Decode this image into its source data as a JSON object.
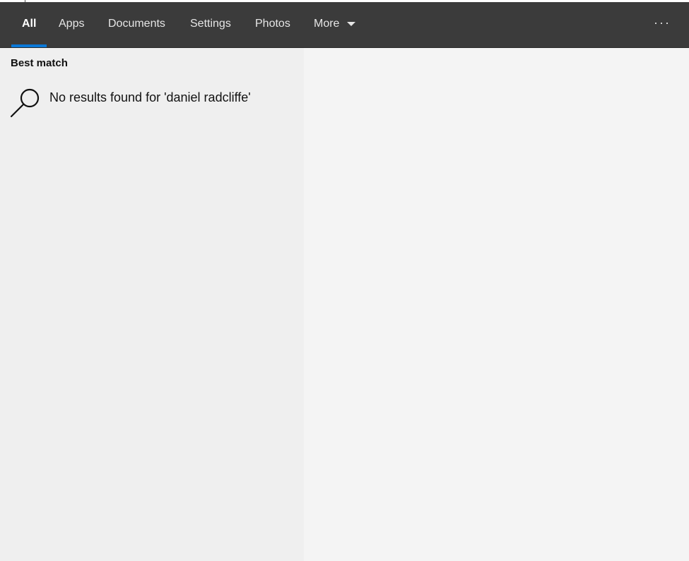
{
  "tabs": [
    {
      "label": "All",
      "active": true
    },
    {
      "label": "Apps"
    },
    {
      "label": "Documents"
    },
    {
      "label": "Settings"
    },
    {
      "label": "Photos"
    },
    {
      "label": "More"
    }
  ],
  "more_icon": "chevron-down-icon",
  "overflow_menu_label": "···",
  "best_match": {
    "title": "Best match",
    "icon": "search-icon",
    "message": "No results found for 'daniel radcliffe'"
  },
  "colors": {
    "tabbar_bg": "#3b3b3b",
    "accent": "#0a78d7",
    "left_pane_bg": "#efefef",
    "right_pane_bg": "#f4f4f4"
  }
}
